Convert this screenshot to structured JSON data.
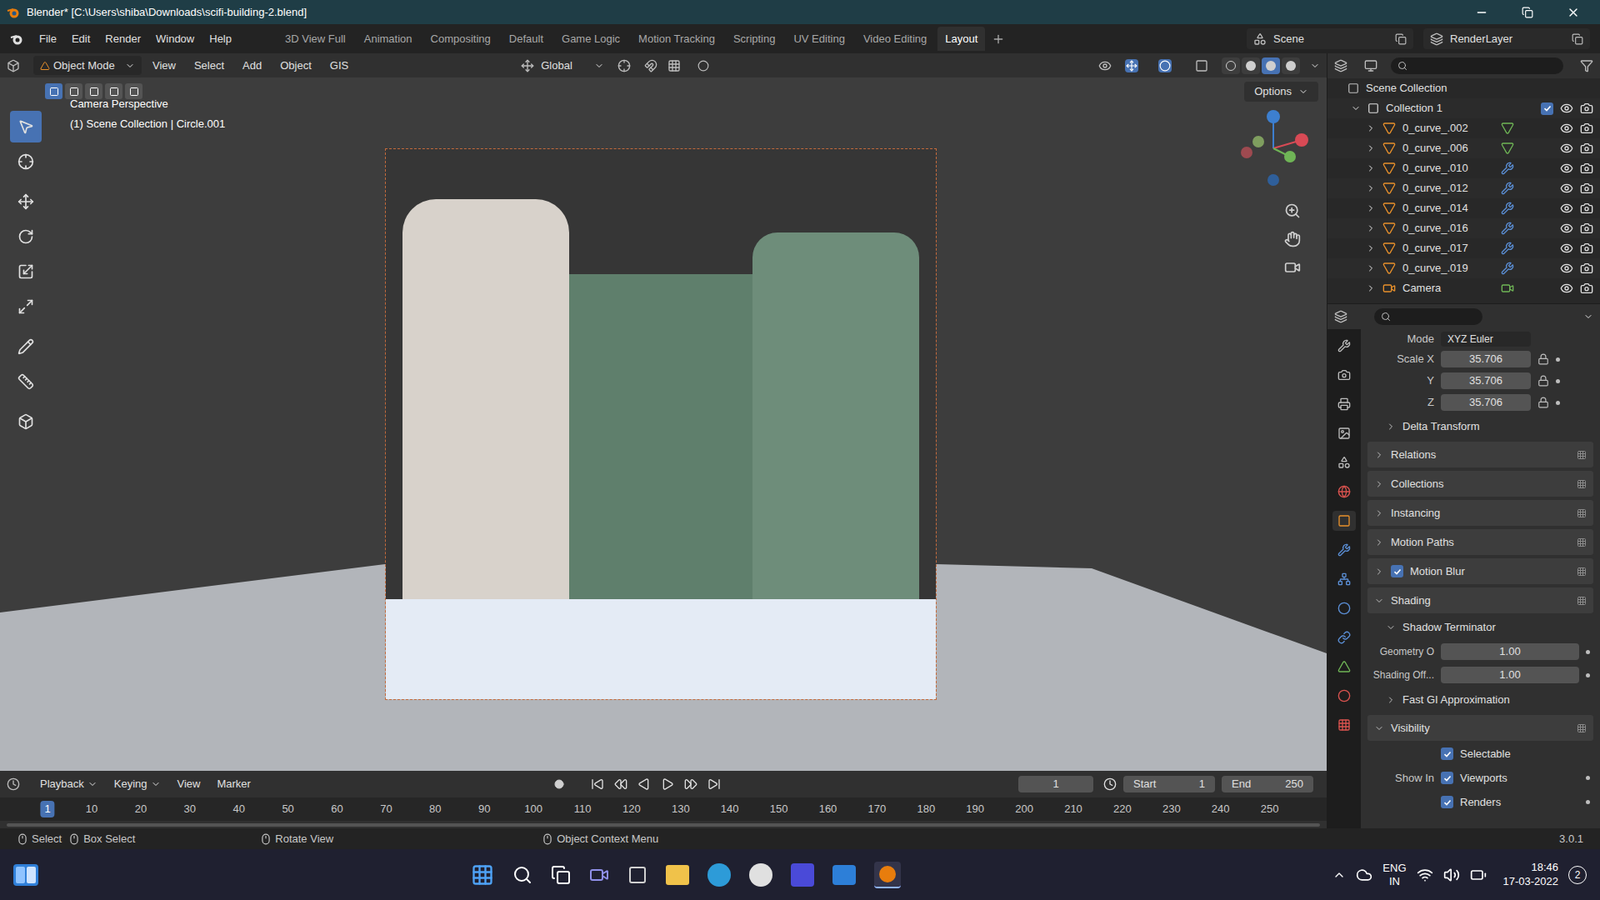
{
  "window": {
    "title": "Blender* [C:\\Users\\shiba\\Downloads\\scifi-building-2.blend]"
  },
  "menu": [
    "File",
    "Edit",
    "Render",
    "Window",
    "Help"
  ],
  "workspaces": [
    {
      "label": "3D View Full",
      "selected": false
    },
    {
      "label": "Animation",
      "selected": false
    },
    {
      "label": "Compositing",
      "selected": false
    },
    {
      "label": "Default",
      "selected": false
    },
    {
      "label": "Game Logic",
      "selected": false
    },
    {
      "label": "Motion Tracking",
      "selected": false
    },
    {
      "label": "Scripting",
      "selected": false
    },
    {
      "label": "UV Editing",
      "selected": false
    },
    {
      "label": "Video Editing",
      "selected": false
    },
    {
      "label": "Layout",
      "selected": true
    }
  ],
  "scene": "Scene",
  "view_layer": "RenderLayer",
  "viewport_header": {
    "mode": "Object Mode",
    "menus": [
      "View",
      "Select",
      "Add",
      "Object",
      "GIS"
    ],
    "orientation": "Global",
    "select_modes": [
      {
        "selected": true
      },
      {
        "selected": false
      },
      {
        "selected": false
      },
      {
        "selected": false
      },
      {
        "selected": false
      }
    ],
    "shading_modes": [
      {
        "selected": false
      },
      {
        "selected": false
      },
      {
        "selected": true
      },
      {
        "selected": false
      }
    ]
  },
  "viewport": {
    "view_name": "Camera Perspective",
    "context": "(1) Scene Collection | Circle.001",
    "options": "Options",
    "tools": [
      {
        "selected": true
      },
      {
        "selected": false
      },
      {
        "selected": false
      },
      {
        "selected": false
      },
      {
        "selected": false
      },
      {
        "selected": false
      },
      {
        "selected": false
      },
      {
        "selected": false
      },
      {
        "selected": false
      }
    ]
  },
  "outliner": {
    "root": "Scene Collection",
    "collection": {
      "name": "Collection 1",
      "checked": true
    },
    "items": [
      {
        "name": "0_curve_.002",
        "kind": "mesh"
      },
      {
        "name": "0_curve_.006",
        "kind": "mesh"
      },
      {
        "name": "0_curve_.010",
        "kind": "modifier"
      },
      {
        "name": "0_curve_.012",
        "kind": "modifier"
      },
      {
        "name": "0_curve_.014",
        "kind": "modifier"
      },
      {
        "name": "0_curve_.016",
        "kind": "modifier"
      },
      {
        "name": "0_curve_.017",
        "kind": "modifier"
      },
      {
        "name": "0_curve_.019",
        "kind": "modifier"
      },
      {
        "name": "Camera",
        "kind": "camera"
      }
    ]
  },
  "properties": {
    "mode_label": "Mode",
    "mode_value": "XYZ Euler",
    "scale": [
      {
        "label": "Scale X",
        "value": "35.706"
      },
      {
        "label": "Y",
        "value": "35.706"
      },
      {
        "label": "Z",
        "value": "35.706"
      }
    ],
    "rows": [
      {
        "kind": "subpanel",
        "label": "Delta Transform",
        "expanded": false
      },
      {
        "kind": "panel",
        "label": "Relations",
        "expanded": false
      },
      {
        "kind": "panel",
        "label": "Collections",
        "expanded": false
      },
      {
        "kind": "panel",
        "label": "Instancing",
        "expanded": false
      },
      {
        "kind": "panel",
        "label": "Motion Paths",
        "expanded": false
      },
      {
        "kind": "checkpanel",
        "label": "Motion Blur",
        "expanded": false,
        "checked": true
      },
      {
        "kind": "panel",
        "label": "Shading",
        "expanded": true
      },
      {
        "kind": "subpanel",
        "label": "Shadow Terminator",
        "expanded": true
      },
      {
        "kind": "field",
        "label": "Geometry O",
        "value": "1.00"
      },
      {
        "kind": "field",
        "label": "Shading Off...",
        "value": "1.00"
      },
      {
        "kind": "subpanel",
        "label": "Fast GI Approximation",
        "expanded": false
      },
      {
        "kind": "panel",
        "label": "Visibility",
        "expanded": true
      },
      {
        "kind": "check",
        "prefix": "",
        "label": "Selectable",
        "checked": true
      },
      {
        "kind": "check",
        "prefix": "Show In",
        "label": "Viewports",
        "checked": true
      },
      {
        "kind": "check",
        "prefix": "",
        "label": "Renders",
        "checked": true
      }
    ]
  },
  "timeline": {
    "menus": [
      "Playback",
      "Keying",
      "View",
      "Marker"
    ],
    "current_frame": "1",
    "start_label": "Start",
    "start": "1",
    "end_label": "End",
    "end": "250",
    "ticks": [
      "1",
      "10",
      "20",
      "30",
      "40",
      "50",
      "60",
      "70",
      "80",
      "90",
      "100",
      "110",
      "120",
      "130",
      "140",
      "150",
      "160",
      "170",
      "180",
      "190",
      "200",
      "210",
      "220",
      "230",
      "240",
      "250"
    ]
  },
  "status_bar": {
    "items": [
      "Select",
      "Box Select",
      "Rotate View",
      "Object Context Menu"
    ],
    "version": "3.0.1"
  },
  "taskbar": {
    "language": "ENG",
    "region": "IN",
    "time": "18:46",
    "date": "17-03-2022",
    "notifications": "2"
  }
}
